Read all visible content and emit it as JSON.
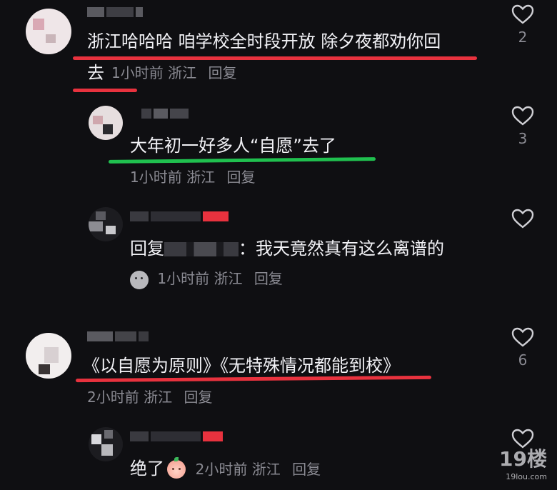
{
  "comments": [
    {
      "text": "浙江哈哈哈 咱学校全时段开放 除夕夜都劝你回",
      "text_line2": "去",
      "time": "1小时前",
      "location": "浙江",
      "reply_label": "回复",
      "likes": "2"
    },
    {
      "text": "大年初一好多人“自愿”去了",
      "time": "1小时前",
      "location": "浙江",
      "reply_label": "回复",
      "likes": "3"
    },
    {
      "reply_prefix": "回复",
      "text": "：我天竟然真有这么离谱的",
      "time": "1小时前",
      "location": "浙江",
      "reply_label": "回复",
      "likes": ""
    },
    {
      "text": "《以自愿为原则》《无特殊情况都能到校》",
      "time": "2小时前",
      "location": "浙江",
      "reply_label": "回复",
      "likes": "6"
    },
    {
      "text": "绝了",
      "time": "2小时前",
      "location": "浙江",
      "reply_label": "回复",
      "likes": ""
    }
  ],
  "icons": {
    "like": "heart-outline-icon",
    "sticker": "peach-face-emoji-icon"
  },
  "colors": {
    "background": "#0f0f12",
    "highlight_red": "#e8323e",
    "highlight_green": "#20c04f",
    "meta_text": "#8a8a92"
  },
  "watermark": {
    "text": "19楼",
    "subtext": "19lou.com"
  }
}
